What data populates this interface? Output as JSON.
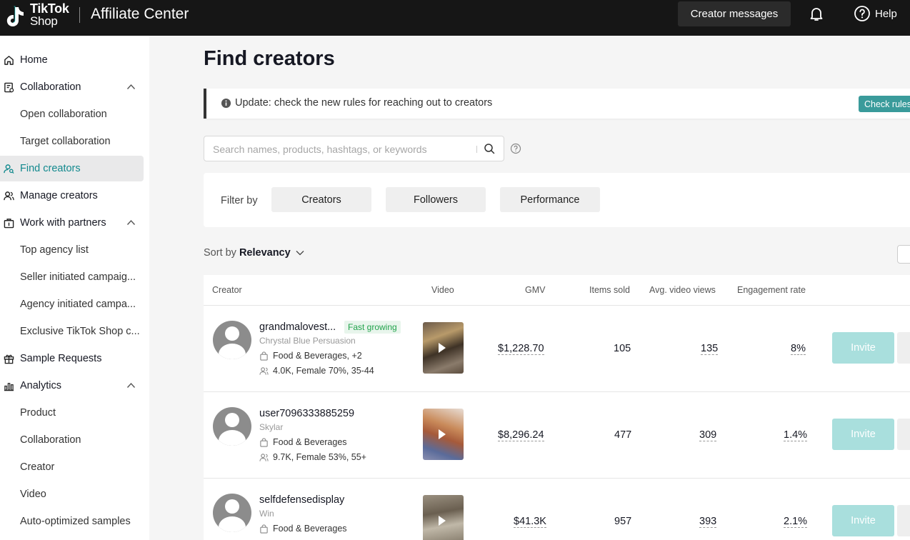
{
  "header": {
    "logo_line1": "TikTok",
    "logo_line2": "Shop",
    "app_title": "Affiliate Center",
    "messages_button": "Creator messages",
    "help_label": "Help"
  },
  "sidebar": {
    "items": [
      {
        "label": "Home",
        "type": "parent",
        "icon": "home-icon"
      },
      {
        "label": "Collaboration",
        "type": "parent",
        "icon": "collaboration-icon",
        "expanded": true
      },
      {
        "label": "Open collaboration",
        "type": "sub"
      },
      {
        "label": "Target collaboration",
        "type": "sub"
      },
      {
        "label": "Find creators",
        "type": "parent",
        "icon": "find-creators-icon",
        "active": true
      },
      {
        "label": "Manage creators",
        "type": "parent",
        "icon": "manage-creators-icon"
      },
      {
        "label": "Work with partners",
        "type": "parent",
        "icon": "partners-icon",
        "expanded": true
      },
      {
        "label": "Top agency list",
        "type": "sub"
      },
      {
        "label": "Seller initiated campaig...",
        "type": "sub"
      },
      {
        "label": "Agency initiated campa...",
        "type": "sub"
      },
      {
        "label": "Exclusive TikTok Shop c...",
        "type": "sub"
      },
      {
        "label": "Sample Requests",
        "type": "parent",
        "icon": "gift-icon"
      },
      {
        "label": "Analytics",
        "type": "parent",
        "icon": "analytics-icon",
        "expanded": true
      },
      {
        "label": "Product",
        "type": "sub"
      },
      {
        "label": "Collaboration",
        "type": "sub"
      },
      {
        "label": "Creator",
        "type": "sub"
      },
      {
        "label": "Video",
        "type": "sub"
      },
      {
        "label": "Auto-optimized samples",
        "type": "sub"
      }
    ]
  },
  "main": {
    "title": "Find creators",
    "banner": {
      "text": "Update: check the new rules for reaching out to creators",
      "button": "Check rules"
    },
    "search": {
      "placeholder": "Search names, products, hashtags, or keywords"
    },
    "filter": {
      "label": "Filter by",
      "buttons": [
        "Creators",
        "Followers",
        "Performance"
      ]
    },
    "sort": {
      "label": "Sort by",
      "value": "Relevancy"
    },
    "table": {
      "columns": [
        "Creator",
        "Video",
        "GMV",
        "Items sold",
        "Avg. video views",
        "Engagement rate"
      ],
      "rows": [
        {
          "name": "grandmalovest...",
          "badge": "Fast growing",
          "subtitle": "Chrystal Blue Persuasion",
          "category": "Food & Beverages, +2",
          "audience": "4.0K, Female 70%, 35-44",
          "gmv": "$1,228.70",
          "items_sold": "105",
          "avg_views": "135",
          "engagement": "8%",
          "action": "Invite"
        },
        {
          "name": "user7096333885259",
          "badge": "",
          "subtitle": "Skylar",
          "category": "Food & Beverages",
          "audience": "9.7K, Female 53%, 55+",
          "gmv": "$8,296.24",
          "items_sold": "477",
          "avg_views": "309",
          "engagement": "1.4%",
          "action": "Invite"
        },
        {
          "name": "selfdefensedisplay",
          "badge": "",
          "subtitle": "Win",
          "category": "Food & Beverages",
          "audience": "",
          "gmv": "$41.3K",
          "items_sold": "957",
          "avg_views": "393",
          "engagement": "2.1%",
          "action": "Invite"
        }
      ]
    }
  },
  "colors": {
    "topbar": "#161616",
    "accent": "#12898e",
    "check_rules_bg": "#3a9b9b",
    "invite_disabled": "#a9dfdd",
    "badge_text": "#22a34c"
  }
}
